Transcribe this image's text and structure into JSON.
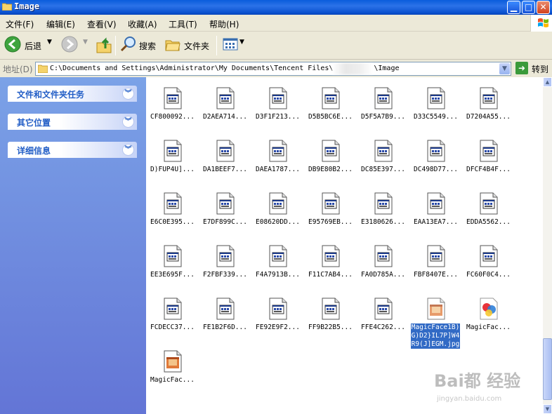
{
  "window": {
    "title": "Image"
  },
  "menu": [
    "文件(F)",
    "编辑(E)",
    "查看(V)",
    "收藏(A)",
    "工具(T)",
    "帮助(H)"
  ],
  "toolbar": {
    "back_label": "后退",
    "search_label": "搜索",
    "folders_label": "文件夹"
  },
  "address": {
    "label": "地址(D)",
    "path_start": "C:\\Documents and Settings\\Administrator\\My Documents\\Tencent Files\\",
    "path_end": "\\Image",
    "go_label": "转到"
  },
  "tasks": [
    {
      "title": "文件和文件夹任务"
    },
    {
      "title": "其它位置"
    },
    {
      "title": "详细信息"
    }
  ],
  "files": [
    {
      "name": "CF800092...",
      "icon": "image-doc-icon"
    },
    {
      "name": "D2AEA714...",
      "icon": "image-doc-icon"
    },
    {
      "name": "D3F1F213...",
      "icon": "image-doc-icon"
    },
    {
      "name": "D5B5BC6E...",
      "icon": "image-doc-icon"
    },
    {
      "name": "D5F5A7B9...",
      "icon": "image-doc-icon"
    },
    {
      "name": "D33C5549...",
      "icon": "image-doc-icon"
    },
    {
      "name": "D7204A55...",
      "icon": "image-doc-icon"
    },
    {
      "name": "D)FUP4U]...",
      "icon": "image-doc-icon"
    },
    {
      "name": "DA1BEEF7...",
      "icon": "image-doc-icon"
    },
    {
      "name": "DAEA1787...",
      "icon": "image-doc-icon"
    },
    {
      "name": "DB9E80B2...",
      "icon": "image-doc-icon"
    },
    {
      "name": "DC85E397...",
      "icon": "image-doc-icon"
    },
    {
      "name": "DC498D77...",
      "icon": "image-doc-icon"
    },
    {
      "name": "DFCF4B4F...",
      "icon": "image-doc-icon"
    },
    {
      "name": "E6C0E395...",
      "icon": "image-doc-icon"
    },
    {
      "name": "E7DF899C...",
      "icon": "image-doc-icon"
    },
    {
      "name": "E08620DD...",
      "icon": "image-doc-icon"
    },
    {
      "name": "E95769EB...",
      "icon": "image-doc-icon"
    },
    {
      "name": "E3180626...",
      "icon": "image-doc-icon"
    },
    {
      "name": "EAA13EA7...",
      "icon": "image-doc-icon"
    },
    {
      "name": "EDDA5562...",
      "icon": "image-doc-icon"
    },
    {
      "name": "EE3E695F...",
      "icon": "image-doc-icon"
    },
    {
      "name": "F2FBF339...",
      "icon": "image-doc-icon"
    },
    {
      "name": "F4A7913B...",
      "icon": "image-doc-icon"
    },
    {
      "name": "F11C7AB4...",
      "icon": "image-doc-icon"
    },
    {
      "name": "FA0D785A...",
      "icon": "image-doc-icon"
    },
    {
      "name": "FBF8407E...",
      "icon": "image-doc-icon"
    },
    {
      "name": "FC60F0C4...",
      "icon": "image-doc-icon"
    },
    {
      "name": "FCDECC37...",
      "icon": "image-doc-icon"
    },
    {
      "name": "FE1B2F6D...",
      "icon": "image-doc-icon"
    },
    {
      "name": "FE92E9F2...",
      "icon": "image-doc-icon"
    },
    {
      "name": "FF9B22B5...",
      "icon": "image-doc-icon"
    },
    {
      "name": "FFE4C262...",
      "icon": "image-doc-icon"
    },
    {
      "name": "MagicFace1B)G)D2}IL7P]W4R9(J]EGM.jpg",
      "icon": "magicface-jpg-icon",
      "selected": true
    },
    {
      "name": "MagicFac...",
      "icon": "magicface-colorful-icon"
    },
    {
      "name": "MagicFac...",
      "icon": "magicface-jpg-icon"
    }
  ],
  "watermark": {
    "text": "Bai都 经验",
    "sub": "jingyan.baidu.com"
  },
  "colors": {
    "accent": "#316ac5",
    "task_pane": "#6375d6",
    "title_bar": "#0a5ddb"
  }
}
